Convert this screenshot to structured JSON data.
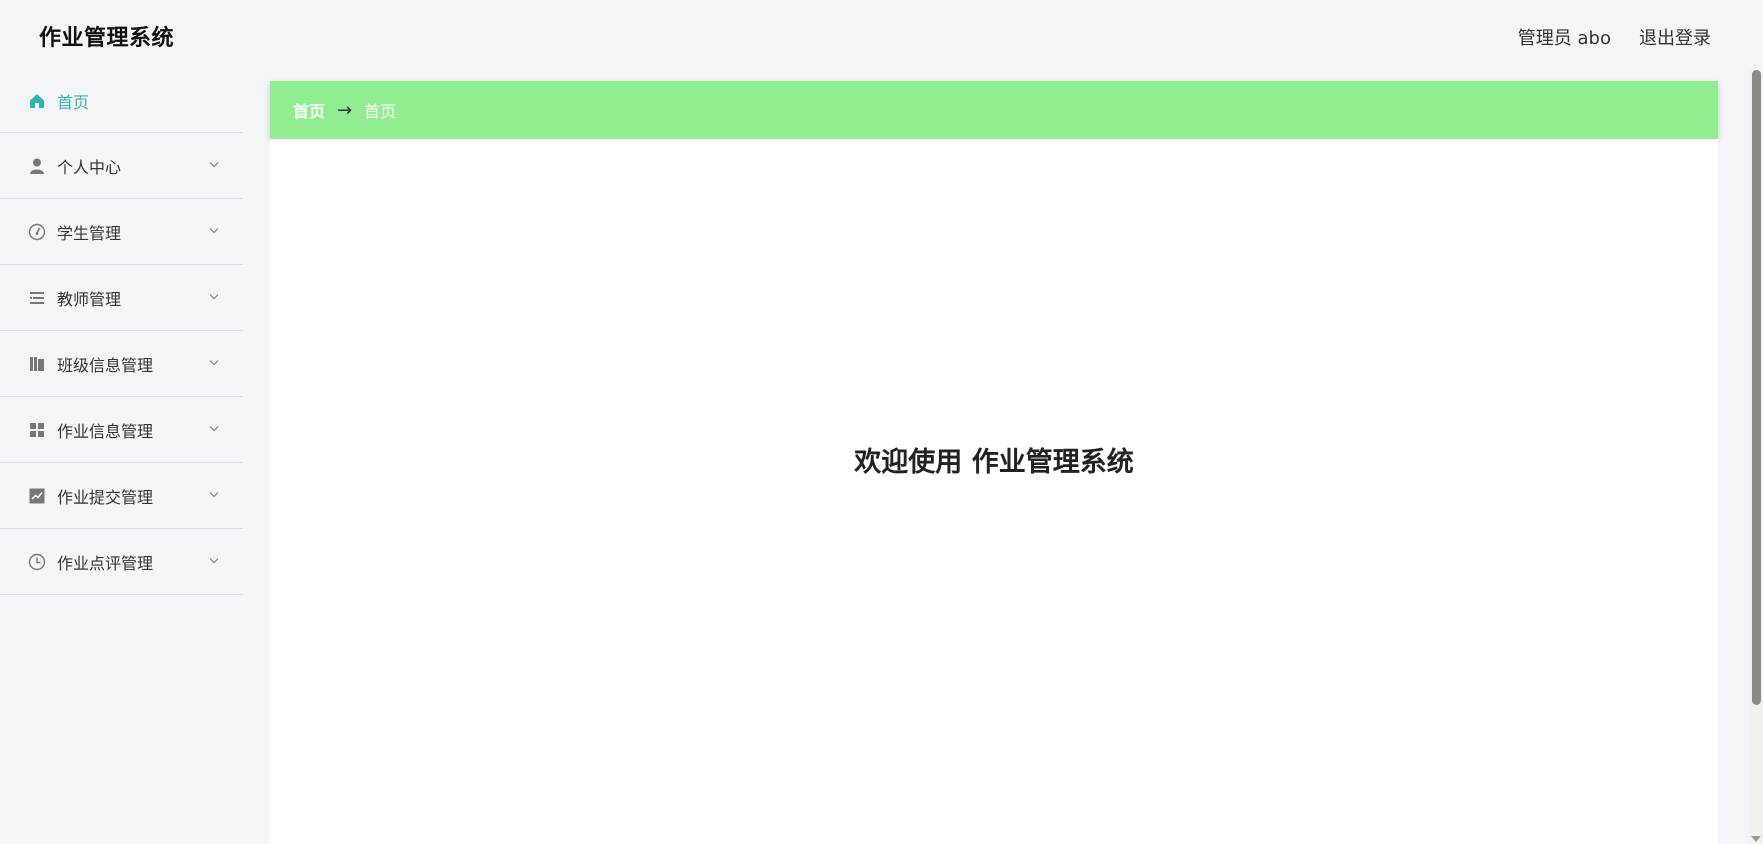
{
  "header": {
    "app_title": "作业管理系统",
    "user_label": "管理员 abo",
    "logout_label": "退出登录"
  },
  "sidebar": {
    "items": [
      {
        "label": "首页",
        "icon": "home-icon",
        "active": true
      },
      {
        "label": "个人中心",
        "icon": "user-icon"
      },
      {
        "label": "学生管理",
        "icon": "gauge-icon"
      },
      {
        "label": "教师管理",
        "icon": "list-icon"
      },
      {
        "label": "班级信息管理",
        "icon": "books-icon"
      },
      {
        "label": "作业信息管理",
        "icon": "grid-icon"
      },
      {
        "label": "作业提交管理",
        "icon": "chart-icon"
      },
      {
        "label": "作业点评管理",
        "icon": "clock-icon"
      }
    ]
  },
  "breadcrumb": {
    "first": "首页",
    "separator": "→",
    "second": "首页"
  },
  "main": {
    "welcome_text": "欢迎使用 作业管理系统"
  },
  "colors": {
    "accent": "#2fb3ad",
    "breadcrumb_bg": "#90ee90",
    "page_bg": "#f4f5f9"
  }
}
